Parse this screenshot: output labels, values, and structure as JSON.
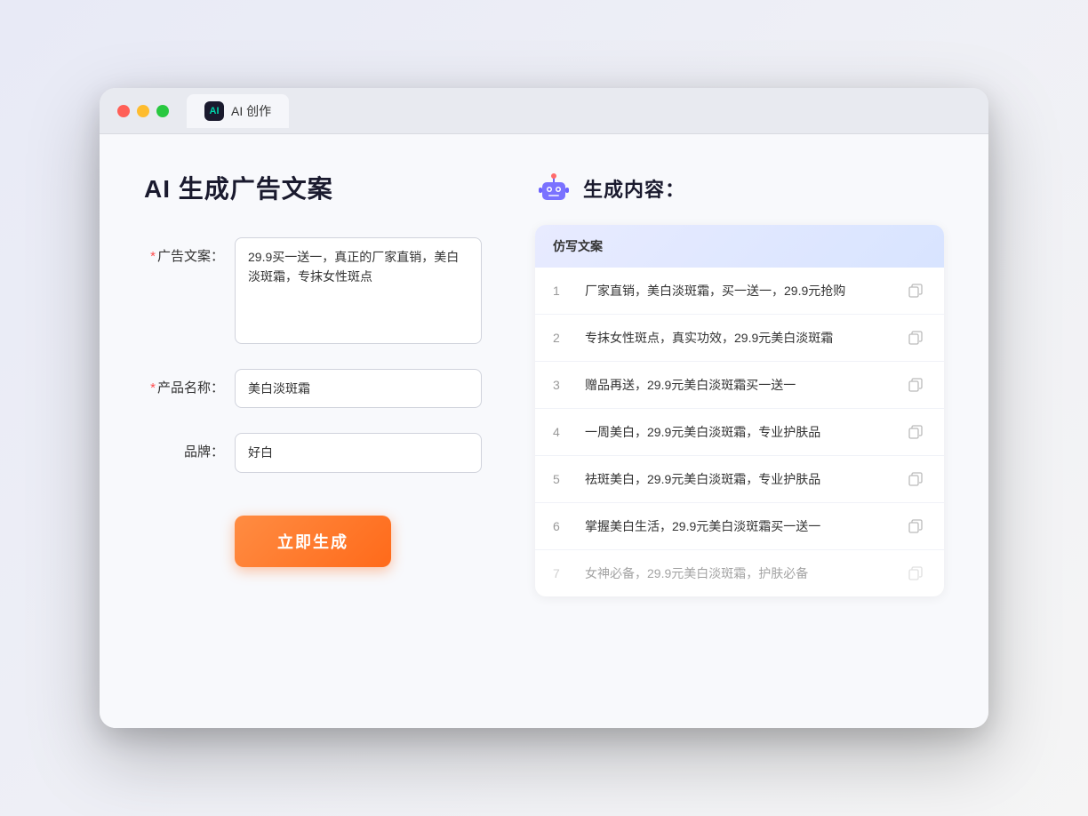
{
  "window": {
    "tab_label": "AI 创作"
  },
  "page": {
    "title": "AI 生成广告文案",
    "result_title": "生成内容："
  },
  "form": {
    "ad_copy_label": "广告文案：",
    "ad_copy_required": true,
    "ad_copy_value": "29.9买一送一，真正的厂家直销，美白淡斑霜，专抹女性斑点",
    "product_name_label": "产品名称：",
    "product_name_required": true,
    "product_name_value": "美白淡斑霜",
    "brand_label": "品牌：",
    "brand_required": false,
    "brand_value": "好白",
    "generate_button": "立即生成"
  },
  "results": {
    "table_header": "仿写文案",
    "items": [
      {
        "num": "1",
        "text": "厂家直销，美白淡斑霜，买一送一，29.9元抢购",
        "dimmed": false
      },
      {
        "num": "2",
        "text": "专抹女性斑点，真实功效，29.9元美白淡斑霜",
        "dimmed": false
      },
      {
        "num": "3",
        "text": "赠品再送，29.9元美白淡斑霜买一送一",
        "dimmed": false
      },
      {
        "num": "4",
        "text": "一周美白，29.9元美白淡斑霜，专业护肤品",
        "dimmed": false
      },
      {
        "num": "5",
        "text": "祛斑美白，29.9元美白淡斑霜，专业护肤品",
        "dimmed": false
      },
      {
        "num": "6",
        "text": "掌握美白生活，29.9元美白淡斑霜买一送一",
        "dimmed": false
      },
      {
        "num": "7",
        "text": "女神必备，29.9元美白淡斑霜，护肤必备",
        "dimmed": true
      }
    ]
  }
}
